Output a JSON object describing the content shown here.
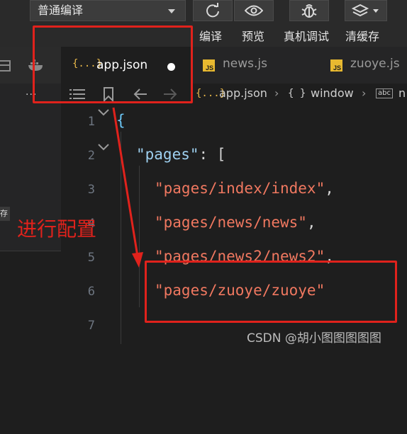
{
  "toolbar": {
    "compile_mode": "普通编译",
    "refresh_icon": "refresh-icon",
    "preview_icon": "eye-icon",
    "debug_icon": "bug-icon",
    "cache_icon": "layers-icon",
    "labels": [
      "编译",
      "预览",
      "真机调试",
      "清缓存"
    ]
  },
  "tabs": [
    {
      "icon": "{...}",
      "name": "app.json",
      "active": true,
      "modified": true
    },
    {
      "icon": "JS",
      "name": "news.js",
      "active": false
    },
    {
      "icon": "JS",
      "name": "zuoye.js",
      "active": false
    }
  ],
  "left_panel": {
    "more": "...",
    "tag": "存"
  },
  "breadcrumb": [
    {
      "icon": "{...}",
      "label": "app.json"
    },
    {
      "icon": "{ }",
      "label": "window"
    },
    {
      "icon": "abc",
      "label": "n"
    }
  ],
  "editor": {
    "lines": [
      {
        "n": "1",
        "text": "{"
      },
      {
        "n": "2",
        "key": "\"pages\"",
        "rest": ": ["
      },
      {
        "n": "3",
        "str": "\"pages/index/index\"",
        "rest": ","
      },
      {
        "n": "4",
        "str": "\"pages/news/news\"",
        "rest": ","
      },
      {
        "n": "5",
        "str": "\"pages/news2/news2\"",
        "rest": ","
      },
      {
        "n": "6",
        "str": "\"pages/zuoye/zuoye\"",
        "rest": ""
      },
      {
        "n": "7",
        "text": ""
      }
    ]
  },
  "annotation": {
    "text": "进行配置",
    "color": "#e0221c"
  },
  "watermark": "CSDN @胡小图图图图图",
  "colors": {
    "string": "#f07860",
    "key": "#9ed0f0",
    "brace": "#6cc6f5",
    "js_badge": "#e8b930"
  }
}
